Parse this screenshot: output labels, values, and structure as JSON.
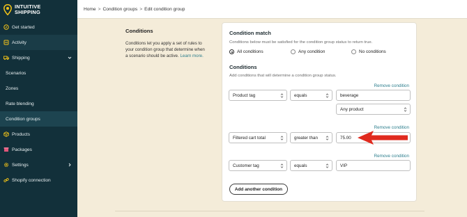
{
  "brand": {
    "name_line1": "INTUITIVE",
    "name_line2": "SHIPPING"
  },
  "sidebar": {
    "items": [
      {
        "label": "Get started",
        "icon": "compass-icon"
      },
      {
        "label": "Activity",
        "icon": "activity-icon"
      },
      {
        "label": "Shipping",
        "icon": "truck-icon",
        "expanded": true
      },
      {
        "label": "Scenarios"
      },
      {
        "label": "Zones"
      },
      {
        "label": "Rate blending"
      },
      {
        "label": "Condition groups",
        "active": true
      },
      {
        "label": "Products",
        "icon": "box-icon"
      },
      {
        "label": "Packages",
        "icon": "package-icon"
      },
      {
        "label": "Settings",
        "icon": "gear-icon"
      },
      {
        "label": "Shopify connection",
        "icon": "link-icon"
      }
    ]
  },
  "breadcrumb": {
    "home": "Home",
    "sep": ">",
    "groups": "Condition groups",
    "current": "Edit condition group"
  },
  "description": {
    "title": "Conditions",
    "text": "Conditions let you apply a set of rules to your condition group that determine when a scenario should be active.",
    "learn_more": "Learn more."
  },
  "condition_match": {
    "title": "Condition match",
    "help": "Conditions below must be satisfied for the condition group status to return true.",
    "options": [
      "All conditions",
      "Any condition",
      "No conditions"
    ],
    "selected": "All conditions"
  },
  "conditions_section": {
    "title": "Conditions",
    "help": "Add conditions that will determine a condition group status.",
    "remove_label": "Remove condition",
    "rows": [
      {
        "field": "Product tag",
        "operator": "equals",
        "value": "beverage",
        "extra": "Any product"
      },
      {
        "field": "Filtered cart total",
        "operator": "greater than",
        "value": "75.00"
      },
      {
        "field": "Customer tag",
        "operator": "equals",
        "value": "VIP"
      }
    ],
    "add_button": "Add another condition"
  },
  "colors": {
    "sidebar_bg": "#12303a",
    "page_bg": "#f4ecd9",
    "link": "#2a7d8c",
    "arrow": "#e02a1e",
    "logo_yellow": "#f5c518"
  }
}
